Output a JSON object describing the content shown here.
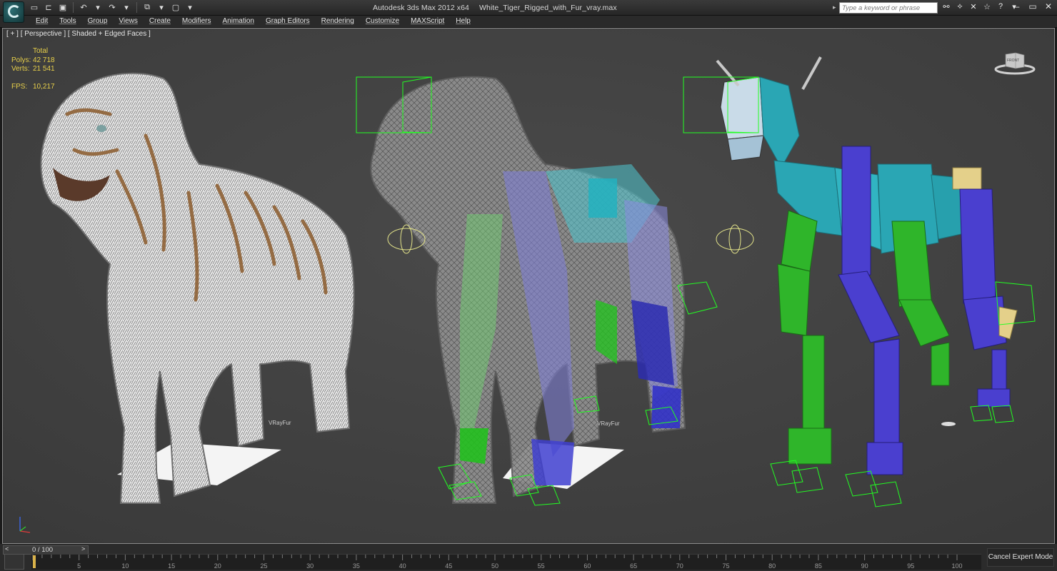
{
  "app": {
    "title": "Autodesk 3ds Max  2012 x64",
    "file": "White_Tiger_Rigged_with_Fur_vray.max",
    "search_placeholder": "Type a keyword or phrase"
  },
  "menu": [
    "Edit",
    "Tools",
    "Group",
    "Views",
    "Create",
    "Modifiers",
    "Animation",
    "Graph Editors",
    "Rendering",
    "Customize",
    "MAXScript",
    "Help"
  ],
  "viewport": {
    "label": "[ + ] [ Perspective ] [ Shaded + Edged Faces ]",
    "stats": {
      "header": "Total",
      "polys_label": "Polys:",
      "polys": "42 718",
      "verts_label": "Verts:",
      "verts": "21 541",
      "fps_label": "FPS:",
      "fps": "10,217"
    },
    "fur_labels": [
      "VRayFur",
      "VRayFur"
    ],
    "viewcube_text": "FRONT"
  },
  "timeline": {
    "left_arrow": "<",
    "right_arrow": ">",
    "frame_display": "0 / 100",
    "tick_numbers": [
      5,
      10,
      15,
      20,
      25,
      30,
      35,
      40,
      45,
      50,
      55,
      60,
      65,
      70,
      75,
      80,
      85,
      90,
      95,
      100
    ]
  },
  "status": {
    "cancel_expert": "Cancel Expert Mode"
  },
  "colors": {
    "stats": "#e8d04a",
    "bone_green": "#2fb52a",
    "bone_blue": "#4a3fcf",
    "bone_teal": "#2aa6b4",
    "bone_yellow": "#e4d08a",
    "helper_green": "#22ff22"
  }
}
